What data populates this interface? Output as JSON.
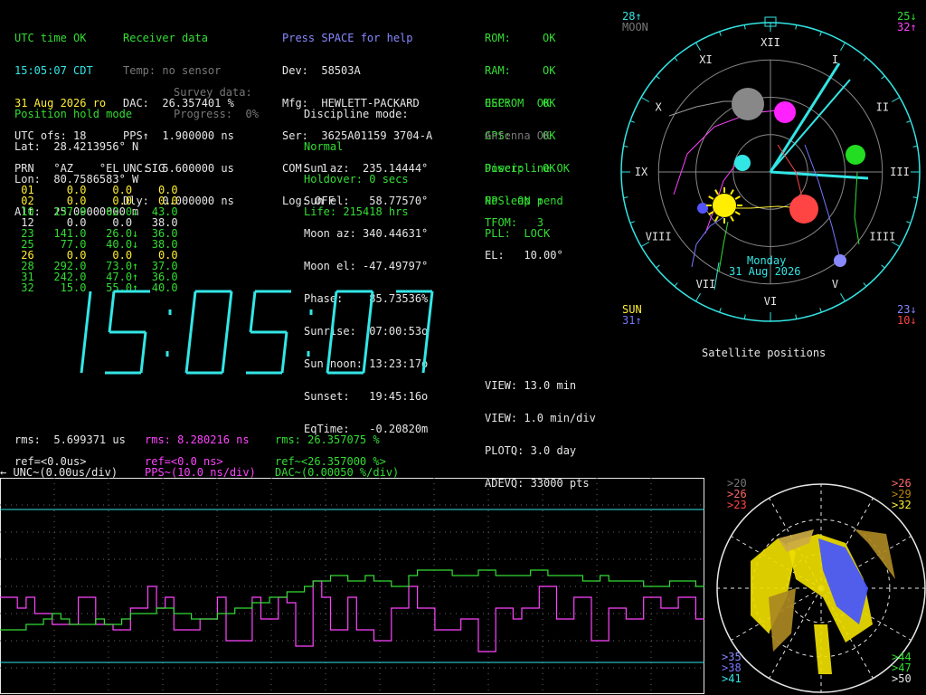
{
  "status": {
    "utc_status": "UTC time OK",
    "time_line": "15:05:07 CDT",
    "date_line": "31 Aug 2026 ro",
    "utc_ofs": "UTC ofs: 18"
  },
  "receiver": {
    "title": "Receiver data",
    "temp": "Temp: no sensor",
    "dac": "DAC:  26.357401 %",
    "pps": "PPS↑  1.900000 ns",
    "unc": "UNC:  5.600000 us",
    "dly": "Dly:  0.000000 ns"
  },
  "device": {
    "help": "Press SPACE for help",
    "dev": "Dev:  58503A",
    "mfg": "Mfg:  HEWLETT-PACKARD",
    "ser": "Ser:  3625A01159 3704-A",
    "com": "COM:  1",
    "log": "Log: OFF"
  },
  "checks": [
    {
      "label": "ROM:",
      "value": "OK"
    },
    {
      "label": "RAM:",
      "value": "OK"
    },
    {
      "label": "OSC:",
      "value": "OK"
    },
    {
      "label": "GPS:",
      "value": "OK"
    },
    {
      "label": "Power:",
      "value": "OK"
    }
  ],
  "checks2": {
    "eeprom": "EEPROM  OK",
    "antenna": "Antenna OK",
    "discipline": "Discipline OK",
    "leap": "No leap pend"
  },
  "position": {
    "title": "Position hold mode",
    "lat": "Lat:  28.4213956° N",
    "lon": "Lon:  80.7586583° W",
    "alt": "Alt:  25.09000000 m",
    "survey": "Survey data:",
    "progress": "Progress:  0%"
  },
  "discipline": {
    "title": "Discipline mode:",
    "mode": "Normal",
    "holdover": "Holdover: 0 secs",
    "life": "Life: 215418 hrs"
  },
  "sat_table": {
    "header": "PRN   °AZ    °EL    SIG",
    "rows": [
      {
        "text": " 01     0.0    0.0    0.0",
        "color": "#ffee33"
      },
      {
        "text": " 02     0.0    0.0    0.0",
        "color": "#ffee33"
      },
      {
        "text": " 10   137.0   62.0↓  43.0",
        "color": "#33dd33"
      },
      {
        "text": " 12     0.0    0.0   38.0",
        "color": "#e6e6e6"
      },
      {
        "text": " 23   141.0   26.0↓  36.0",
        "color": "#33dd33"
      },
      {
        "text": " 25    77.0   40.0↓  38.0",
        "color": "#33dd33"
      },
      {
        "text": " 26     0.0    0.0    0.0",
        "color": "#ffee33"
      },
      {
        "text": " 28   292.0   73.0↑  37.0",
        "color": "#33dd33"
      },
      {
        "text": " 31   242.0   47.0↑  36.0",
        "color": "#33dd33"
      },
      {
        "text": " 32    15.0   55.0↑  40.0",
        "color": "#33dd33"
      }
    ]
  },
  "sun_moon": {
    "sun_az": "Sun az:  235.14444°",
    "sun_el": "Sun el:   58.77570°",
    "moon_az": "Moon az: 340.44631°",
    "moon_el": "Moon el: -47.49797°",
    "phase": "Phase:    85.73536%",
    "sunrise": "Sunrise:  07:00:53o",
    "sun_noon": "Sun noon: 13:23:17o",
    "sunset": "Sunset:   19:45:16o",
    "eqtime": "EqTime:   -0.20820m"
  },
  "pps_status": {
    "pps": "PPS: ON ↑",
    "tfom": "TFOM:   3",
    "pll": "PLL:  LOCK",
    "el": "EL:   10.00°"
  },
  "clock": {
    "time": "15:05:07"
  },
  "view": {
    "view1": "VIEW: 13.0 min",
    "view2": "VIEW: 1.0 min/div",
    "plotq": "PLOTQ: 3.0 day",
    "adevq": "ADEVQ: 33000 pts"
  },
  "rms": {
    "unc": "rms:  5.699371 us",
    "pps": "rms: 8.280216 ns",
    "dac": "rms: 26.357075 %"
  },
  "plot_legend": {
    "ref_unc": "ref=<0.0us>",
    "unc_scale": "← UNC~(0.00us/div)",
    "ref_pps": "ref=<0.0 ns>",
    "pps_scale": "PPS~(10.0 ns/div)",
    "ref_dac": "ref~<26.357000 %>",
    "dac_scale": "DAC~(0.00050 %/div)"
  },
  "sky_map": {
    "caption": "Satellite positions",
    "day": "Monday",
    "date": "31 Aug 2026",
    "hours": [
      "XII",
      "I",
      "II",
      "III",
      "IIII",
      "V",
      "VI",
      "VII",
      "VIII",
      "IX",
      "X",
      "XI"
    ],
    "corner_tl1": "28↑",
    "corner_tl2": "MOON",
    "corner_tr1": "25↓",
    "corner_tr2": "32↑",
    "corner_bl1": "SUN",
    "corner_bl2": "31↑",
    "corner_br1": "23↓",
    "corner_br2": "10↓"
  },
  "signal_map": {
    "tl": [
      ">20",
      ">26",
      ">23"
    ],
    "tr": [
      ">26",
      ">29",
      ">32"
    ],
    "bl": [
      ">35",
      ">38",
      ">41"
    ],
    "br": [
      ">44",
      ">47",
      ">50"
    ]
  },
  "colors": {
    "cyan": "#33e6e6",
    "green": "#33dd33",
    "yellow": "#ffee33",
    "magenta": "#ff44ff",
    "grey": "#777777",
    "red": "#ff4444",
    "blue": "#7777ff"
  },
  "chart_data": {
    "type": "line",
    "xlabel": "",
    "ylabel": "",
    "series": [
      {
        "name": "PPS~(10.0 ns/div)",
        "values": [
          22,
          22,
          24,
          22,
          25,
          25,
          27,
          27,
          27,
          22,
          22,
          27,
          27,
          28,
          28,
          24,
          24,
          20,
          24,
          22,
          28,
          28,
          28,
          26,
          26,
          22,
          30,
          30,
          30,
          22,
          26,
          26,
          22,
          23,
          31,
          31,
          19,
          22,
          28,
          28,
          22,
          28,
          28,
          30,
          30,
          24,
          24,
          20,
          24,
          24,
          28,
          28,
          28,
          26,
          26,
          32,
          32,
          24,
          24,
          26,
          24,
          24,
          20,
          20,
          26,
          26,
          22,
          22,
          30,
          30,
          24,
          24,
          26,
          26,
          22,
          22,
          24,
          24,
          22,
          22,
          26,
          26
        ]
      },
      {
        "name": "DAC~(0.00050 %/div)",
        "values": [
          28,
          28,
          28,
          27,
          27,
          26,
          25,
          26,
          27,
          27,
          27,
          26,
          27,
          27,
          26,
          25,
          25,
          25,
          24,
          24,
          25,
          25,
          26,
          26,
          26,
          25,
          25,
          24,
          24,
          23,
          23,
          22,
          22,
          21,
          21,
          20,
          19,
          19,
          18,
          18,
          19,
          19,
          18,
          19,
          19,
          20,
          20,
          18,
          17,
          17,
          17,
          17,
          18,
          18,
          18,
          17,
          17,
          18,
          18,
          18,
          18,
          17,
          17,
          18,
          18,
          18,
          18,
          19,
          19,
          18,
          19,
          19,
          19,
          19,
          20,
          20,
          20,
          19,
          19,
          19,
          20,
          20
        ]
      }
    ],
    "y_units": "arbitrary"
  }
}
